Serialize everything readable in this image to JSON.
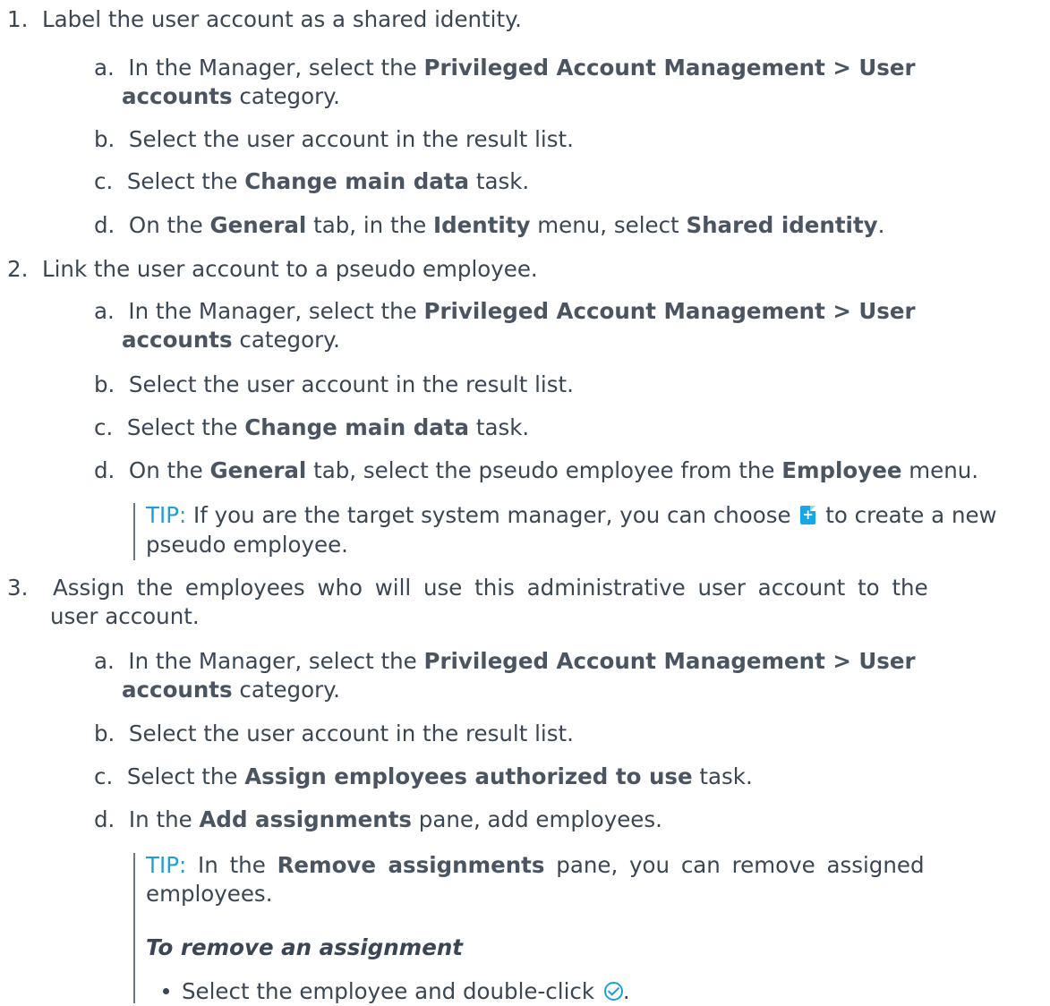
{
  "steps": [
    {
      "num": "1.",
      "text": "Label the user account as a shared identity.",
      "a": {
        "l": "a.",
        "t1": "In the Manager, select the ",
        "b1": "Privileged Account Management > User",
        "b2": "accounts",
        "t2": " category."
      },
      "b": {
        "l": "b.",
        "t": "Select the user account in the result list."
      },
      "c": {
        "l": "c.",
        "t1": "Select the ",
        "b1": "Change main data",
        "t2": " task."
      },
      "d": {
        "l": "d.",
        "t1": "On the ",
        "b1": "General",
        "t2": " tab, in the ",
        "b2": "Identity",
        "t3": " menu, select ",
        "b3": "Shared identity",
        "t4": "."
      }
    },
    {
      "num": "2.",
      "text": "Link the user account to a pseudo employee.",
      "a": {
        "l": "a.",
        "t1": "In the Manager, select the ",
        "b1": "Privileged Account Management > User",
        "b2": "accounts",
        "t2": " category."
      },
      "b": {
        "l": "b.",
        "t": "Select the user account in the result list."
      },
      "c": {
        "l": "c.",
        "t1": "Select the ",
        "b1": "Change main data",
        "t2": " task."
      },
      "d": {
        "l": "d.",
        "t1": "On the ",
        "b1": "General",
        "t2": " tab, select the pseudo employee from the ",
        "b2": "Employee",
        "t3": " menu."
      },
      "tip": {
        "label": "TIP:",
        "t1": " If you are the target system manager, you can choose ",
        "t2": " to create a new",
        "t3": "pseudo employee."
      }
    },
    {
      "num": "3.",
      "text1": "Assign the employees who will use this administrative user account to the",
      "text2": "user  account.",
      "a": {
        "l": "a.",
        "t1": "In the Manager, select the ",
        "b1": "Privileged Account Management > User",
        "b2": "accounts",
        "t2": " category."
      },
      "b": {
        "l": "b.",
        "t": "Select the user account in the result list."
      },
      "c": {
        "l": "c.",
        "t1": "Select the ",
        "b1": "Assign employees authorized to use",
        "t2": " task."
      },
      "d": {
        "l": "d.",
        "t1": "In the ",
        "b1": "Add assignments",
        "t2": " pane, add employees."
      },
      "tip": {
        "label": "TIP:",
        "t1": " In the ",
        "b1": "Remove assignments",
        "t2": " pane, you can remove assigned",
        "t3": "employees."
      },
      "sub_heading": "To remove an assignment",
      "bullet": "Select the employee and double-click "
    }
  ],
  "icons": {
    "new": "add-document-icon",
    "assigned": "checkmark-circle-icon"
  },
  "colors": {
    "text": "#3b4654",
    "tip": "#1e9fd6",
    "icon": "#17a7e6"
  }
}
